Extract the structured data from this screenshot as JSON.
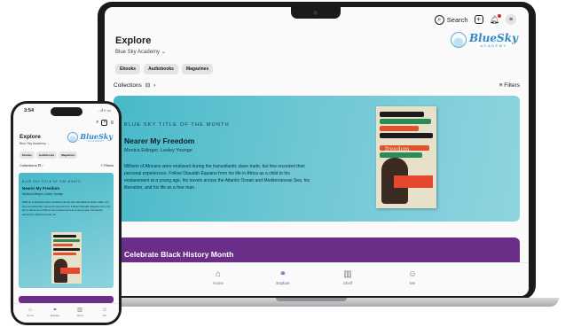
{
  "app": {
    "title": "Explore",
    "library": "Blue Sky Academy",
    "logo_text": "BlueSky",
    "logo_tagline": "ACADEMY"
  },
  "toolbar": {
    "search_label": "Search"
  },
  "phone_status": {
    "time": "3:54",
    "indicators": "..ıl ≈ ▭"
  },
  "chips": [
    "Ebooks",
    "Audiobooks",
    "Magazines"
  ],
  "collections": {
    "label": "Collections",
    "filters_label": "Filters"
  },
  "feature": {
    "kicker": "BLUE SKY TITLE OF THE MONTH",
    "title": "Nearer My Freedom",
    "authors": "Monica Edinger, Lesley Younge",
    "description": "Millions of Africans were enslaved during the transatlantic slave trade, but few recorded their personal experiences. Follow Olaudah Equiano from his life in Africa as a child to his enslavement at a young age, his travels across the Atlantic Ocean and Mediterranean Sea, his liberation, and his life as a free man.",
    "phone_description": "Millions of Africans were enslaved during the transatlantic slave trade, but few recorded their personal experiences. Follow Olaudah Equiano from his life in Africa as a child to his enslavement at a young age, his travels across the Atlantic Ocean an..."
  },
  "book_cover": {
    "title": "nearer my freedom"
  },
  "promo": {
    "title": "Celebrate Black History Month"
  },
  "tabs": [
    {
      "label": "Home",
      "icon": "home-icon",
      "active": false
    },
    {
      "label": "Explore",
      "icon": "explore-icon",
      "active": true
    },
    {
      "label": "Shelf",
      "icon": "shelf-icon",
      "active": false
    },
    {
      "label": "Me",
      "icon": "me-icon",
      "active": false
    }
  ],
  "colors": {
    "feature_bg": "#6ec6d4",
    "promo_bg": "#6a2e88",
    "accent": "#5e4fb0",
    "brand": "#2f88c5",
    "notification_dot": "#d8232a"
  }
}
